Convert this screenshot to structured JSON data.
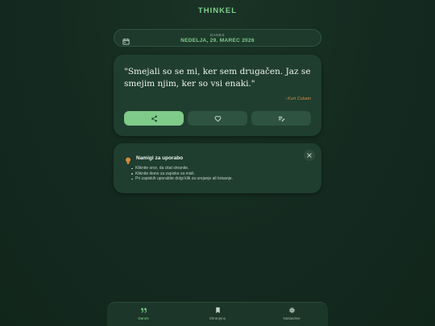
{
  "app": {
    "title": "THINKEL"
  },
  "date": {
    "label": "DANES",
    "value": "NEDELJA, 29. MAREC 2026"
  },
  "quote": {
    "text": "\"Smejali so se mi, ker sem drugačen. Jaz se smejim njim, ker so vsi enaki.\"",
    "author": "- Kurt Cobain"
  },
  "actions": [
    {
      "name": "share",
      "icon": "share-icon",
      "active": true
    },
    {
      "name": "favorite",
      "icon": "heart-icon",
      "active": false
    },
    {
      "name": "note",
      "icon": "edit-note-icon",
      "active": false
    }
  ],
  "tips": {
    "title": "Namigi za uporabo",
    "items": [
      "Kliknite srce, da citat shranite.",
      "Kliknite ikono za zapiske za misli.",
      "Pri zapiskih uporabite dolgi klik za urejanje ali brisanje."
    ]
  },
  "nav": {
    "items": [
      {
        "label": "Danes",
        "icon": "quote-icon",
        "active": true
      },
      {
        "label": "Shranjeno",
        "icon": "bookmark-icon",
        "active": false
      },
      {
        "label": "Nastavitve",
        "icon": "gear-icon",
        "active": false
      }
    ]
  },
  "colors": {
    "accent": "#7fcb8a",
    "background": "#15291f",
    "card": "#1f3e2f",
    "author": "#d68a3d"
  }
}
